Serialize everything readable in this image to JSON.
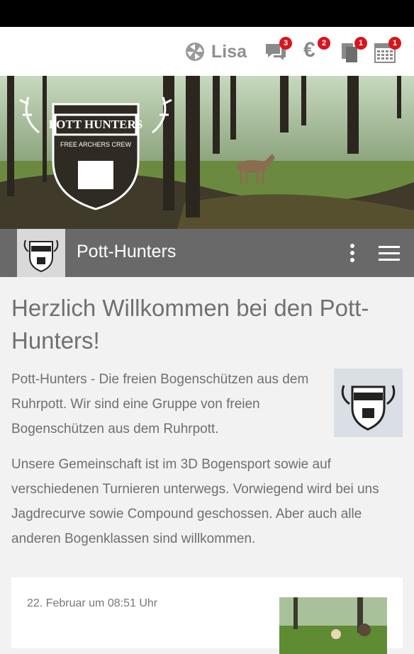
{
  "user": {
    "name": "Lisa"
  },
  "toolbar": {
    "messages_badge": "3",
    "payments_badge": "2",
    "documents_badge": "1",
    "calendar_badge": "1",
    "euro_symbol": "€"
  },
  "subheader": {
    "title": "Pott-Hunters"
  },
  "main": {
    "heading": "Herzlich Willkommen bei den Pott-Hunters!",
    "intro": "Pott-Hunters - Die freien Bogenschützen aus dem Ruhrpott. Wir sind eine Gruppe von freien Bogenschützen aus dem Ruhrpott.",
    "body": "Unsere Gemeinschaft ist im 3D Bogensport sowie auf verschiedenen Turnieren unterwegs. Vorwiegend wird bei uns Jagdrecurve sowie Compound geschossen. Aber auch alle anderen Bogenklassen sind willkommen."
  },
  "post": {
    "date": "22. Februar um 08:51 Uhr"
  },
  "logo": {
    "line1": "POTT HUNTERS",
    "line2": "FREE ARCHERS CREW"
  },
  "colors": {
    "badge": "#d9141c",
    "subbar": "#696969",
    "text": "#6f6f6f",
    "icon": "#8f8f8f"
  }
}
